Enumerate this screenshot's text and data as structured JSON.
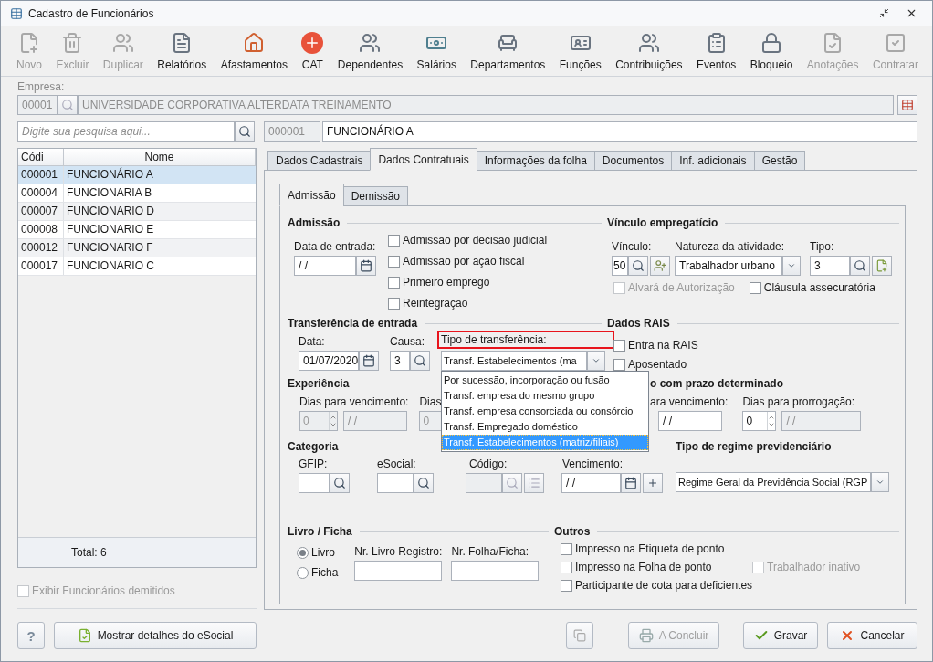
{
  "window": {
    "title": "Cadastro de Funcionários"
  },
  "toolbar": [
    {
      "label": "Novo",
      "disabled": true
    },
    {
      "label": "Excluir",
      "disabled": true
    },
    {
      "label": "Duplicar",
      "disabled": true
    },
    {
      "label": "Relatórios",
      "disabled": false
    },
    {
      "label": "Afastamentos",
      "disabled": false
    },
    {
      "label": "CAT",
      "disabled": false
    },
    {
      "label": "Dependentes",
      "disabled": false
    },
    {
      "label": "Salários",
      "disabled": false
    },
    {
      "label": "Departamentos",
      "disabled": false
    },
    {
      "label": "Funções",
      "disabled": false
    },
    {
      "label": "Contribuições",
      "disabled": false
    },
    {
      "label": "Eventos",
      "disabled": false
    },
    {
      "label": "Bloqueio",
      "disabled": false
    },
    {
      "label": "Anotações",
      "disabled": true
    },
    {
      "label": "Contratar",
      "disabled": true
    }
  ],
  "empresa": {
    "label": "Empresa:",
    "code": "00001",
    "name": "UNIVERSIDADE CORPORATIVA ALTERDATA TREINAMENTO"
  },
  "search": {
    "placeholder": "Digite sua pesquisa aqui...",
    "code": "000001",
    "name": "FUNCIONÁRIO A"
  },
  "employee_list": {
    "columns": [
      "Códi",
      "Nome"
    ],
    "rows": [
      {
        "code": "000001",
        "name": "FUNCIONÁRIO A",
        "selected": true
      },
      {
        "code": "000004",
        "name": "FUNCIONARIA B",
        "selected": false
      },
      {
        "code": "000007",
        "name": "FUNCIONARIO D",
        "selected": false
      },
      {
        "code": "000008",
        "name": "FUNCIONARIO E",
        "selected": false
      },
      {
        "code": "000012",
        "name": "FUNCIONARIO F",
        "selected": false
      },
      {
        "code": "000017",
        "name": "FUNCIONARIO C",
        "selected": false
      }
    ],
    "total": "Total: 6",
    "show_dismissed": {
      "label": "Exibir Funcionários demitidos",
      "checked": false,
      "disabled": true
    }
  },
  "tabs": [
    {
      "label": "Dados Cadastrais",
      "selected": false
    },
    {
      "label": "Dados Contratuais",
      "selected": true
    },
    {
      "label": "Informações da folha",
      "selected": false
    },
    {
      "label": "Documentos",
      "selected": false
    },
    {
      "label": "Inf. adicionais",
      "selected": false
    },
    {
      "label": "Gestão",
      "selected": false
    }
  ],
  "subtabs": [
    {
      "label": "Admissão",
      "selected": true
    },
    {
      "label": "Demissão",
      "selected": false
    }
  ],
  "admissao": {
    "title": "Admissão",
    "date_label": "Data de entrada:",
    "date_value": "/ /",
    "checks": [
      {
        "label": "Admissão por decisão judicial",
        "checked": false
      },
      {
        "label": "Admissão por ação fiscal",
        "checked": false
      },
      {
        "label": "Primeiro emprego",
        "checked": false
      },
      {
        "label": "Reintegração",
        "checked": false
      }
    ]
  },
  "vinculo": {
    "title": "Vínculo empregatício",
    "vinculo_label": "Vínculo:",
    "vinculo_value": "50",
    "natureza_label": "Natureza da atividade:",
    "natureza_value": "Trabalhador urbano",
    "tipo_label": "Tipo:",
    "tipo_value": "3",
    "checks": [
      {
        "label": "Alvará de Autorização",
        "checked": false,
        "disabled": true
      },
      {
        "label": "Cláusula assecuratória",
        "checked": false,
        "disabled": false
      }
    ]
  },
  "transferencia": {
    "title": "Transferência de entrada",
    "data_label": "Data:",
    "data_value": "01/07/2020",
    "causa_label": "Causa:",
    "causa_value": "3",
    "tipo_label": "Tipo de transferência:",
    "highlighted": true,
    "tipo_value": "Transf. Estabelecimentos (ma",
    "options": [
      {
        "label": "Por sucessão, incorporação ou fusão",
        "selected": false
      },
      {
        "label": "Transf. empresa do mesmo grupo",
        "selected": false
      },
      {
        "label": "Transf. empresa consorciada ou consórcio",
        "selected": false
      },
      {
        "label": "Transf. Empregado doméstico",
        "selected": false
      },
      {
        "label": "Transf. Estabelecimentos (matriz/filiais)",
        "selected": true
      }
    ]
  },
  "rais": {
    "title": "Dados RAIS",
    "checks": [
      {
        "label": "Entra na RAIS",
        "checked": false
      },
      {
        "label": "Aposentado",
        "checked": false
      }
    ]
  },
  "experiencia": {
    "title": "Experiência",
    "label_1": "Dias para vencimento:",
    "days_1": "0",
    "date_1": "/ /",
    "label_2": "Dias",
    "days_2": "0"
  },
  "contrato": {
    "title": "o com prazo determinado",
    "label_1": "ara vencimento:",
    "date_1": "/ /",
    "label_2": "Dias para prorrogação:",
    "days_2": "0",
    "date_2": "/ /"
  },
  "categoria": {
    "title": "Categoria",
    "gfip_label": "GFIP:",
    "esocial_label": "eSocial:",
    "codigo_label": "Código:",
    "vencimento_label": "Vencimento:",
    "vencimento_value": "/ /"
  },
  "regime": {
    "title": "Tipo de regime previdenciário",
    "value": "Regime Geral da Previdência Social (RGP"
  },
  "livro": {
    "title": "Livro / Ficha",
    "options": [
      {
        "label": "Livro",
        "selected": true
      },
      {
        "label": "Ficha",
        "selected": false
      }
    ],
    "registro_label": "Nr. Livro Registro:",
    "folha_label": "Nr. Folha/Ficha:"
  },
  "outros": {
    "title": "Outros",
    "checks": [
      {
        "label": "Impresso na Etiqueta de ponto",
        "checked": false,
        "disabled": false
      },
      {
        "label": "Impresso na Folha de ponto",
        "checked": false,
        "disabled": false
      },
      {
        "label": "Trabalhador inativo",
        "checked": false,
        "disabled": true
      },
      {
        "label": "Participante de cota para deficientes",
        "checked": false,
        "disabled": false
      }
    ]
  },
  "footer": {
    "help": "?",
    "details": "Mostrar detalhes do eSocial",
    "buttons": [
      {
        "label": "A Concluir",
        "kind": "conclude",
        "disabled": true
      },
      {
        "label": "Gravar",
        "kind": "save",
        "disabled": false
      },
      {
        "label": "Cancelar",
        "kind": "cancel",
        "disabled": false
      }
    ]
  }
}
